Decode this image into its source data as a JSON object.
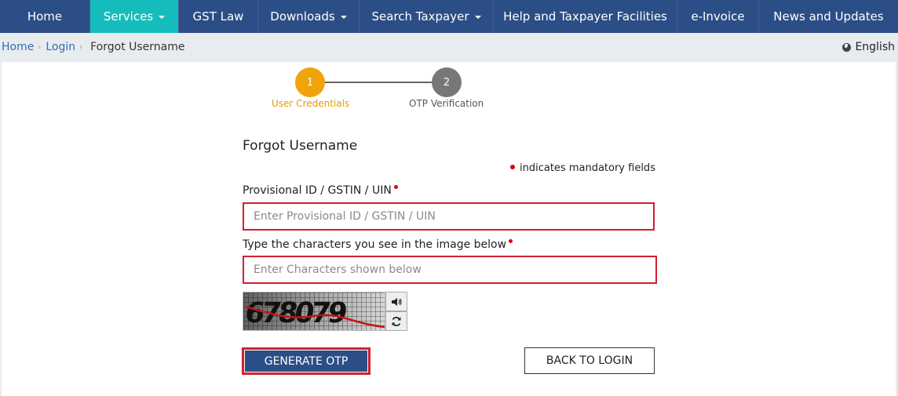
{
  "nav": {
    "items": [
      {
        "label": "Home",
        "dropdown": false
      },
      {
        "label": "Services",
        "dropdown": true,
        "active": true
      },
      {
        "label": "GST Law",
        "dropdown": false
      },
      {
        "label": "Downloads",
        "dropdown": true
      },
      {
        "label": "Search Taxpayer",
        "dropdown": true
      },
      {
        "label": "Help and Taxpayer Facilities",
        "dropdown": false
      },
      {
        "label": "e-Invoice",
        "dropdown": false
      },
      {
        "label": "News and Updates",
        "dropdown": false
      }
    ],
    "color": "#2c4e86",
    "active_color": "#16bcbc"
  },
  "breadcrumb": {
    "items": [
      "Home",
      "Login"
    ],
    "current": "Forgot Username"
  },
  "language": {
    "label": "English",
    "icon": "globe-icon"
  },
  "stepper": {
    "steps": [
      {
        "number": "1",
        "label": "User Credentials",
        "state": "active",
        "color": "#f0a30a"
      },
      {
        "number": "2",
        "label": "OTP Verification",
        "state": "pending",
        "color": "#777777"
      }
    ]
  },
  "form": {
    "title": "Forgot Username",
    "mandatory_note": "indicates mandatory fields",
    "fields": {
      "id": {
        "label": "Provisional ID / GSTIN / UIN",
        "placeholder": "Enter Provisional ID / GSTIN / UIN",
        "value": ""
      },
      "captcha": {
        "label": "Type the characters you see in the image below",
        "placeholder": "Enter Characters shown below",
        "value": ""
      }
    },
    "captcha_image_text": "678079",
    "audio_icon": "speaker-icon",
    "refresh_icon": "refresh-icon"
  },
  "buttons": {
    "generate_otp": "GENERATE OTP",
    "back_to_login": "BACK TO LOGIN"
  },
  "colors": {
    "error_border": "#d0202e",
    "mandatory_dot": "#d9001b",
    "link": "#2f6fb8"
  }
}
